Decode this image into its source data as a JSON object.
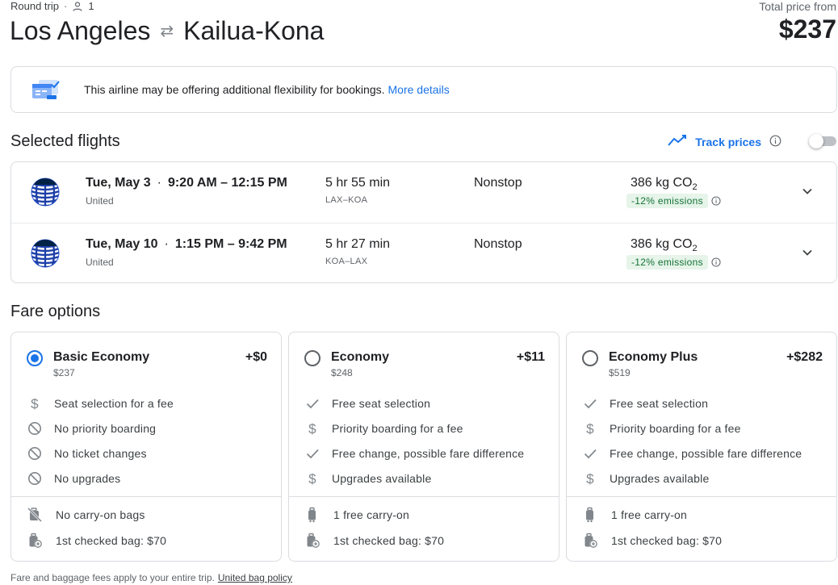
{
  "header": {
    "trip_type": "Round trip",
    "separator": "·",
    "passengers": "1",
    "origin": "Los Angeles",
    "destination": "Kailua-Kona",
    "arrow": "⇄",
    "price_label": "Total price from",
    "price_total": "$237"
  },
  "notice": {
    "text": "This airline may be offering additional flexibility for bookings.",
    "link": "More details"
  },
  "selected_flights": {
    "title": "Selected flights",
    "track_label": "Track prices",
    "track_enabled": false,
    "flights": [
      {
        "date": "Tue, May 3",
        "times": "9:20 AM – 12:15 PM",
        "airline": "United",
        "duration": "5 hr 55 min",
        "route": "LAX–KOA",
        "stops": "Nonstop",
        "co2": "386 kg CO",
        "co2_sub": "2",
        "emissions": "-12% emissions"
      },
      {
        "date": "Tue, May 10",
        "times": "1:15 PM – 9:42 PM",
        "airline": "United",
        "duration": "5 hr 27 min",
        "route": "KOA–LAX",
        "stops": "Nonstop",
        "co2": "386 kg CO",
        "co2_sub": "2",
        "emissions": "-12% emissions"
      }
    ]
  },
  "fare_options": {
    "title": "Fare options",
    "fares": [
      {
        "name": "Basic Economy",
        "price": "$237",
        "delta": "+$0",
        "selected": true,
        "features": [
          {
            "icon": "dollar-icon",
            "text": "Seat selection for a fee"
          },
          {
            "icon": "block-icon",
            "text": "No priority boarding"
          },
          {
            "icon": "block-icon",
            "text": "No ticket changes"
          },
          {
            "icon": "block-icon",
            "text": "No upgrades"
          }
        ],
        "bags": [
          {
            "icon": "no-bag-icon",
            "text": "No carry-on bags"
          },
          {
            "icon": "checked-bag-icon",
            "text": "1st checked bag: $70"
          }
        ]
      },
      {
        "name": "Economy",
        "price": "$248",
        "delta": "+$11",
        "selected": false,
        "features": [
          {
            "icon": "check-icon",
            "text": "Free seat selection"
          },
          {
            "icon": "dollar-icon",
            "text": "Priority boarding for a fee"
          },
          {
            "icon": "check-icon",
            "text": "Free change, possible fare difference"
          },
          {
            "icon": "dollar-icon",
            "text": "Upgrades available"
          }
        ],
        "bags": [
          {
            "icon": "carry-on-icon",
            "text": "1 free carry-on"
          },
          {
            "icon": "checked-bag-icon",
            "text": "1st checked bag: $70"
          }
        ]
      },
      {
        "name": "Economy Plus",
        "price": "$519",
        "delta": "+$282",
        "selected": false,
        "features": [
          {
            "icon": "check-icon",
            "text": "Free seat selection"
          },
          {
            "icon": "dollar-icon",
            "text": "Priority boarding for a fee"
          },
          {
            "icon": "check-icon",
            "text": "Free change, possible fare difference"
          },
          {
            "icon": "dollar-icon",
            "text": "Upgrades available"
          }
        ],
        "bags": [
          {
            "icon": "carry-on-icon",
            "text": "1 free carry-on"
          },
          {
            "icon": "checked-bag-icon",
            "text": "1st checked bag: $70"
          }
        ]
      }
    ]
  },
  "footer": {
    "text": "Fare and baggage fees apply to your entire trip.",
    "link": "United bag policy"
  },
  "colors": {
    "accent": "#1a73e8",
    "emissions_text": "#137333",
    "emissions_bg": "#e6f4ea",
    "united_blue": "#002244"
  }
}
